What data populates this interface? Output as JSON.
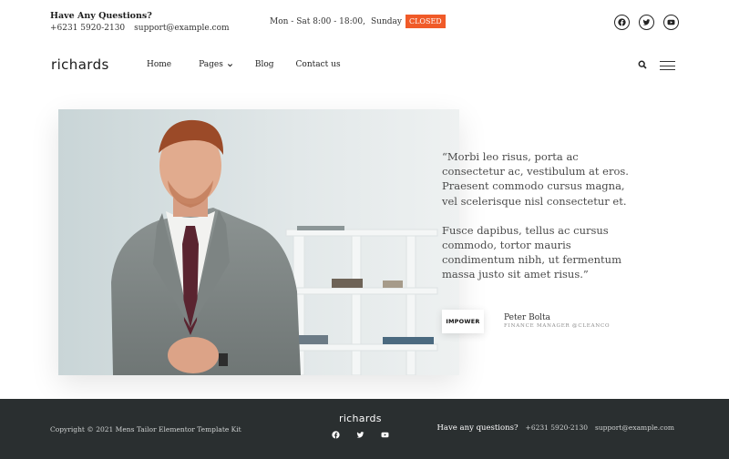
{
  "colors": {
    "accent": "#f05a28",
    "footer_bg": "#2a2f30",
    "text": "#2b2b2b"
  },
  "topbar": {
    "question": "Have Any Questions?",
    "phone": "+6231 5920-2130",
    "email": "support@example.com",
    "hours": "Mon - Sat 8:00 - 18:00,",
    "sunday": "Sunday",
    "closed_badge": "CLOSED",
    "social_icons": [
      "facebook-icon",
      "twitter-icon",
      "youtube-icon"
    ]
  },
  "nav": {
    "logo": "richards",
    "items": [
      {
        "label": "Home"
      },
      {
        "label": "Pages"
      },
      {
        "label": "Blog"
      },
      {
        "label": "Contact us"
      }
    ]
  },
  "testimonial": {
    "paragraph1": "“Morbi leo risus, porta ac consectetur ac, vestibulum at eros. Praesent commodo cursus magna, vel scelerisque nisl consectetur et.",
    "paragraph2": "Fusce dapibus, tellus ac cursus commodo, tortor mauris condimentum nibh, ut fermentum massa justo sit amet risus.”",
    "brand": "IMPOWER",
    "author_name": "Peter Bolta",
    "author_role": "FINANCE MANAGER @CLEANCO"
  },
  "footer": {
    "copyright": "Copyright © 2021 Mens Tailor Elementor Template Kit",
    "logo": "richards",
    "question": "Have any questions?",
    "phone": "+6231 5920-2130",
    "email": "support@example.com",
    "social_icons": [
      "facebook-icon",
      "twitter-icon",
      "youtube-icon"
    ]
  }
}
